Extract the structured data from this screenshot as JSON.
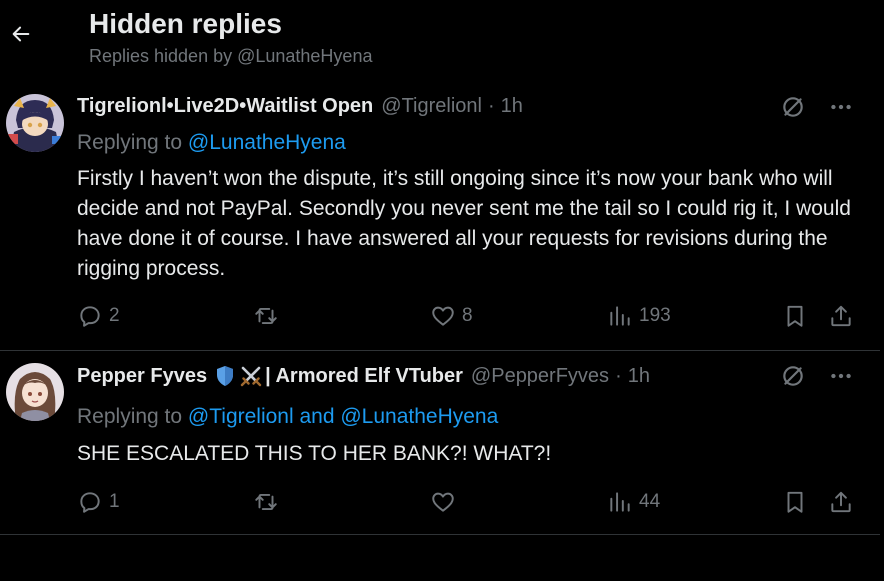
{
  "header": {
    "title": "Hidden replies",
    "subtitle": "Replies hidden by @LunatheHyena"
  },
  "tweets": [
    {
      "display_name": "Tigrelionl•Live2D•Waitlist Open",
      "handle": "@Tigrelionl",
      "dot": "·",
      "time": "1h",
      "replying_prefix": "Replying to",
      "replying_to": "@LunatheHyena",
      "text": "Firstly I haven’t won the dispute, it’s still ongoing since it’s now your bank who will decide and not PayPal. Secondly you never sent me the tail so I could rig it, I would have done it of course. I have answered all your requests for revisions during the rigging process.",
      "replies": "2",
      "reposts": "",
      "likes": "8",
      "views": "193"
    },
    {
      "display_name": "Pepper Fyves",
      "badges": [
        "shield-emoji",
        "crossed-swords-emoji"
      ],
      "name_suffix": "| Armored Elf VTuber",
      "handle": "@PepperFyves",
      "dot": "·",
      "time": "1h",
      "replying_prefix": "Replying to",
      "replying_to": "@Tigrelionl and @LunatheHyena",
      "text": "SHE ESCALATED THIS TO HER BANK?! WHAT?!",
      "replies": "1",
      "reposts": "",
      "likes": "",
      "views": "44"
    }
  ],
  "colors": {
    "background": "#000000",
    "text": "#e7e9ea",
    "secondary": "#71767b",
    "accent": "#1d9bf0",
    "divider": "#2f3336"
  },
  "icons": {
    "back": "arrow-left-icon",
    "hidden": "hide-reply-icon",
    "more": "more-icon",
    "reply": "reply-icon",
    "repost": "repost-icon",
    "like": "heart-icon",
    "views": "views-icon",
    "bookmark": "bookmark-icon",
    "share": "share-icon"
  }
}
